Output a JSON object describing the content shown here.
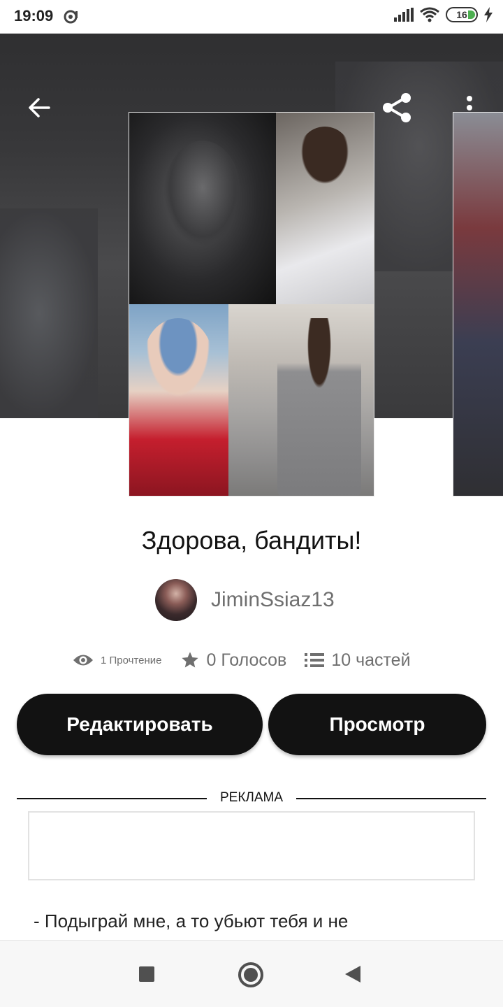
{
  "status_bar": {
    "time": "19:09",
    "battery_level": "16",
    "icons": [
      "sync-icon",
      "signal-icon",
      "wifi-icon",
      "battery-icon",
      "charging-icon"
    ]
  },
  "header": {
    "icons": [
      "back-arrow-icon",
      "share-icon",
      "more-vert-icon"
    ]
  },
  "story": {
    "title": "Здорова, бандиты!",
    "author": "JiminSsiaz13",
    "stats": {
      "reads": "1 Прочтение",
      "votes": "0 Голосов",
      "parts": "10 частей"
    }
  },
  "actions": {
    "edit_label": "Редактировать",
    "view_label": "Просмотр"
  },
  "ad": {
    "label": "РЕКЛАМА"
  },
  "excerpt": "- Подыграй мне, а то убьют тебя и не",
  "colors": {
    "button_bg": "#121212",
    "button_text": "#ffffff",
    "meta_text": "#6f6f6f",
    "hero_bg": "#3a3a3c"
  },
  "nav_bar": {
    "icons": [
      "recents-square-icon",
      "home-circle-icon",
      "back-triangle-icon"
    ]
  }
}
